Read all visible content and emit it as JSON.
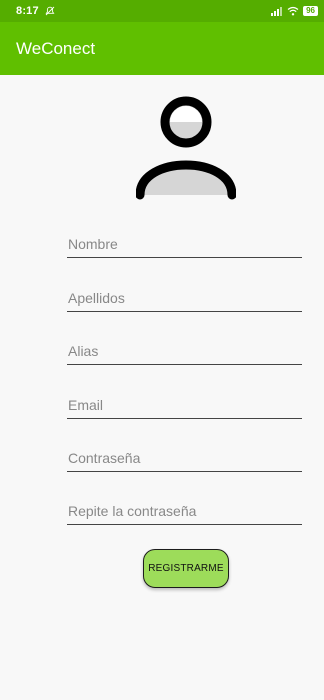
{
  "status_bar": {
    "time": "8:17",
    "battery": "96",
    "icons": [
      "notification-off-icon",
      "signal-icon",
      "wifi-icon",
      "battery-icon"
    ]
  },
  "app_bar": {
    "title": "WeConect"
  },
  "avatar": {
    "icon": "user-avatar-icon"
  },
  "form": {
    "fields": [
      {
        "placeholder": "Nombre",
        "value": ""
      },
      {
        "placeholder": "Apellidos",
        "value": ""
      },
      {
        "placeholder": "Alias",
        "value": ""
      },
      {
        "placeholder": "Email",
        "value": ""
      },
      {
        "placeholder": "Contraseña",
        "value": ""
      },
      {
        "placeholder": "Repite la contraseña",
        "value": ""
      }
    ],
    "submit_label": "REGISTRARME"
  },
  "colors": {
    "status_bar": "#55ad00",
    "app_bar": "#60bf00",
    "button": "#9ddc5a"
  }
}
